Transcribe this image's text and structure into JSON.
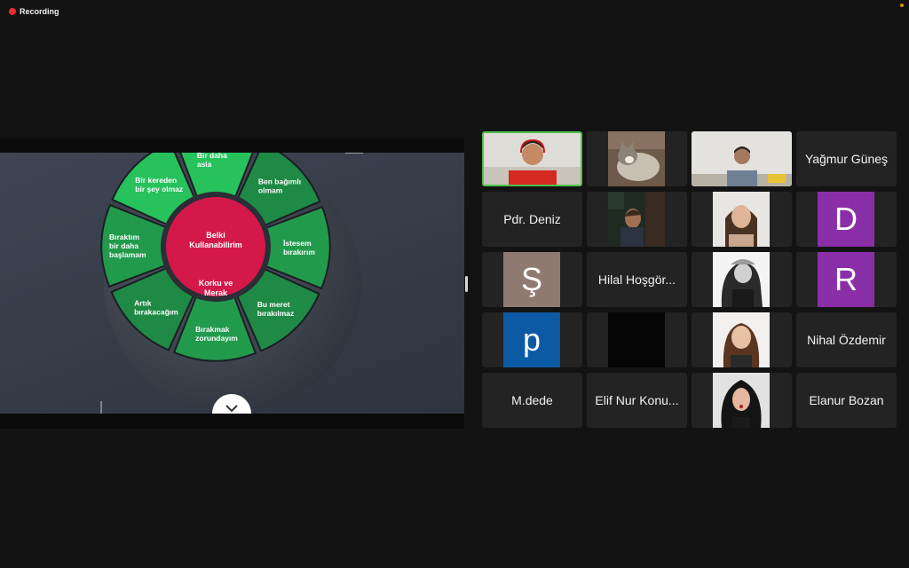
{
  "recording": {
    "label": "Recording"
  },
  "colors": {
    "background": "#131313",
    "tile": "#232323",
    "active_speaker": "#4fc14a",
    "recording": "#e5312b",
    "wheel_light_green": "#27c25c",
    "wheel_dark_green": "#1e8a45",
    "wheel_center": "#d4184a"
  },
  "slide": {
    "center_top": "Belki Kullanabilirim",
    "center_bottom": "Korku ve Merak",
    "segments": [
      "Bir daha asla",
      "Ben bağımlı olmam",
      "İstesem bırakırım",
      "Bu meret bırakılmaz",
      "Bırakmak zorundayım",
      "Artık bırakacağım",
      "Bıraktım bir daha başlamam",
      "Bir kereden bir şey olmaz"
    ],
    "next_icon": "chevron-down-icon"
  },
  "participants": [
    {
      "kind": "video",
      "name": "participant-video-1"
    },
    {
      "kind": "video",
      "name": "participant-video-cat"
    },
    {
      "kind": "video",
      "name": "participant-video-3"
    },
    {
      "kind": "name",
      "label": "Yağmur Güneş"
    },
    {
      "kind": "name",
      "label": "Pdr. Deniz"
    },
    {
      "kind": "video",
      "name": "participant-video-6"
    },
    {
      "kind": "video",
      "name": "participant-video-7"
    },
    {
      "kind": "avatar",
      "letter": "D",
      "color": "#8b2fa8"
    },
    {
      "kind": "avatar",
      "letter": "Ş",
      "color": "#8e7a70"
    },
    {
      "kind": "name",
      "label": "Hilal Hoşgör..."
    },
    {
      "kind": "video",
      "name": "participant-video-11"
    },
    {
      "kind": "avatar",
      "letter": "R",
      "color": "#8b2fa8"
    },
    {
      "kind": "avatar",
      "letter": "p",
      "color": "#0b5aa3"
    },
    {
      "kind": "video",
      "name": "participant-video-14"
    },
    {
      "kind": "video",
      "name": "participant-video-15"
    },
    {
      "kind": "name",
      "label": "Nihal Özdemir"
    },
    {
      "kind": "name",
      "label": "M.dede"
    },
    {
      "kind": "name",
      "label": "Elif Nur Konu..."
    },
    {
      "kind": "video",
      "name": "participant-video-19"
    },
    {
      "kind": "name",
      "label": "Elanur Bozan"
    }
  ]
}
